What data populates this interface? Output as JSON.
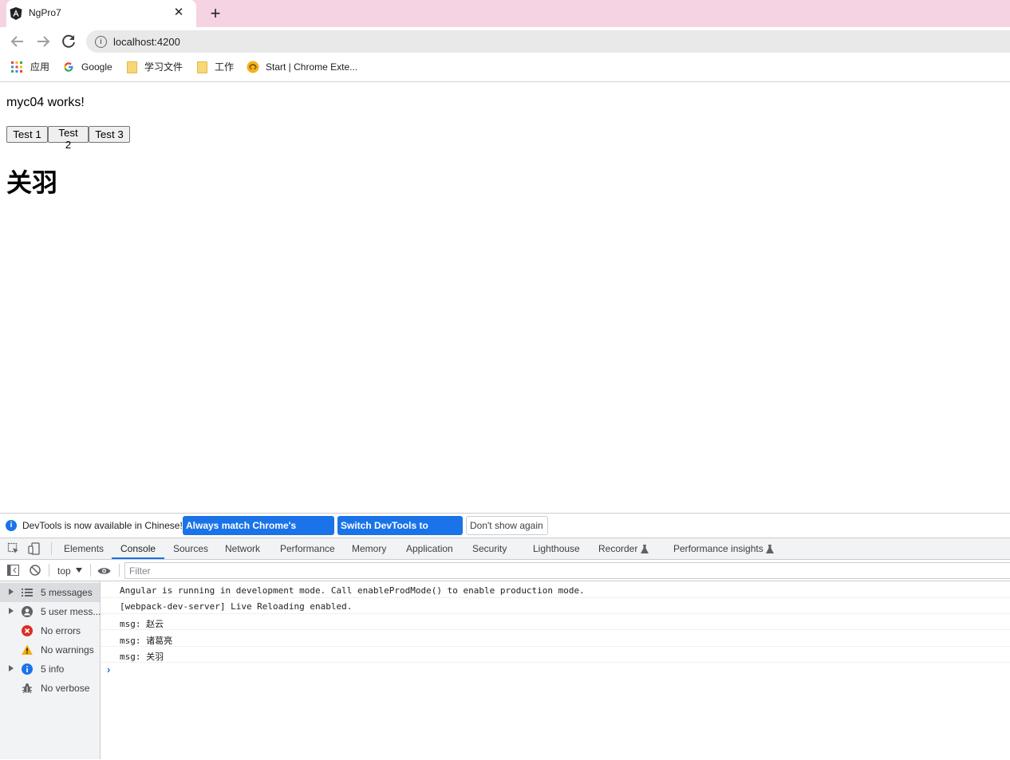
{
  "browser": {
    "tab_title": "NgPro7",
    "tab_close": "✕",
    "new_tab": "+",
    "url": "localhost:4200",
    "bookmarks": {
      "apps": "应用",
      "google": "Google",
      "folder1": "学习文件",
      "folder2": "工作",
      "ext": "Start | Chrome Exte..."
    }
  },
  "page": {
    "paragraph": "myc04 works!",
    "buttons": [
      "Test 1",
      "Test 2",
      "Test 3"
    ],
    "heading": "关羽"
  },
  "devtools": {
    "infobar": {
      "text": "DevTools is now available in Chinese!",
      "btn_match": "Always match Chrome's language",
      "btn_switch": "Switch DevTools to Chinese",
      "btn_dismiss": "Don't show again"
    },
    "tabs": [
      "Elements",
      "Console",
      "Sources",
      "Network",
      "Performance",
      "Memory",
      "Application",
      "Security",
      "Lighthouse",
      "Recorder",
      "Performance insights"
    ],
    "active_tab": "Console",
    "context": "top",
    "filter_placeholder": "Filter",
    "sidebar": [
      "5 messages",
      "5 user mess...",
      "No errors",
      "No warnings",
      "5 info",
      "No verbose"
    ],
    "logs": [
      "Angular is running in development mode. Call enableProdMode() to enable production mode.",
      "[webpack-dev-server] Live Reloading enabled.",
      "msg: 赵云",
      "msg: 诸葛亮",
      "msg: 关羽"
    ],
    "prompt": "›"
  },
  "colors": {
    "tabstrip": "#f6d3e2",
    "accent": "#1a73e8",
    "error": "#d93025",
    "warning": "#f9ab00"
  }
}
